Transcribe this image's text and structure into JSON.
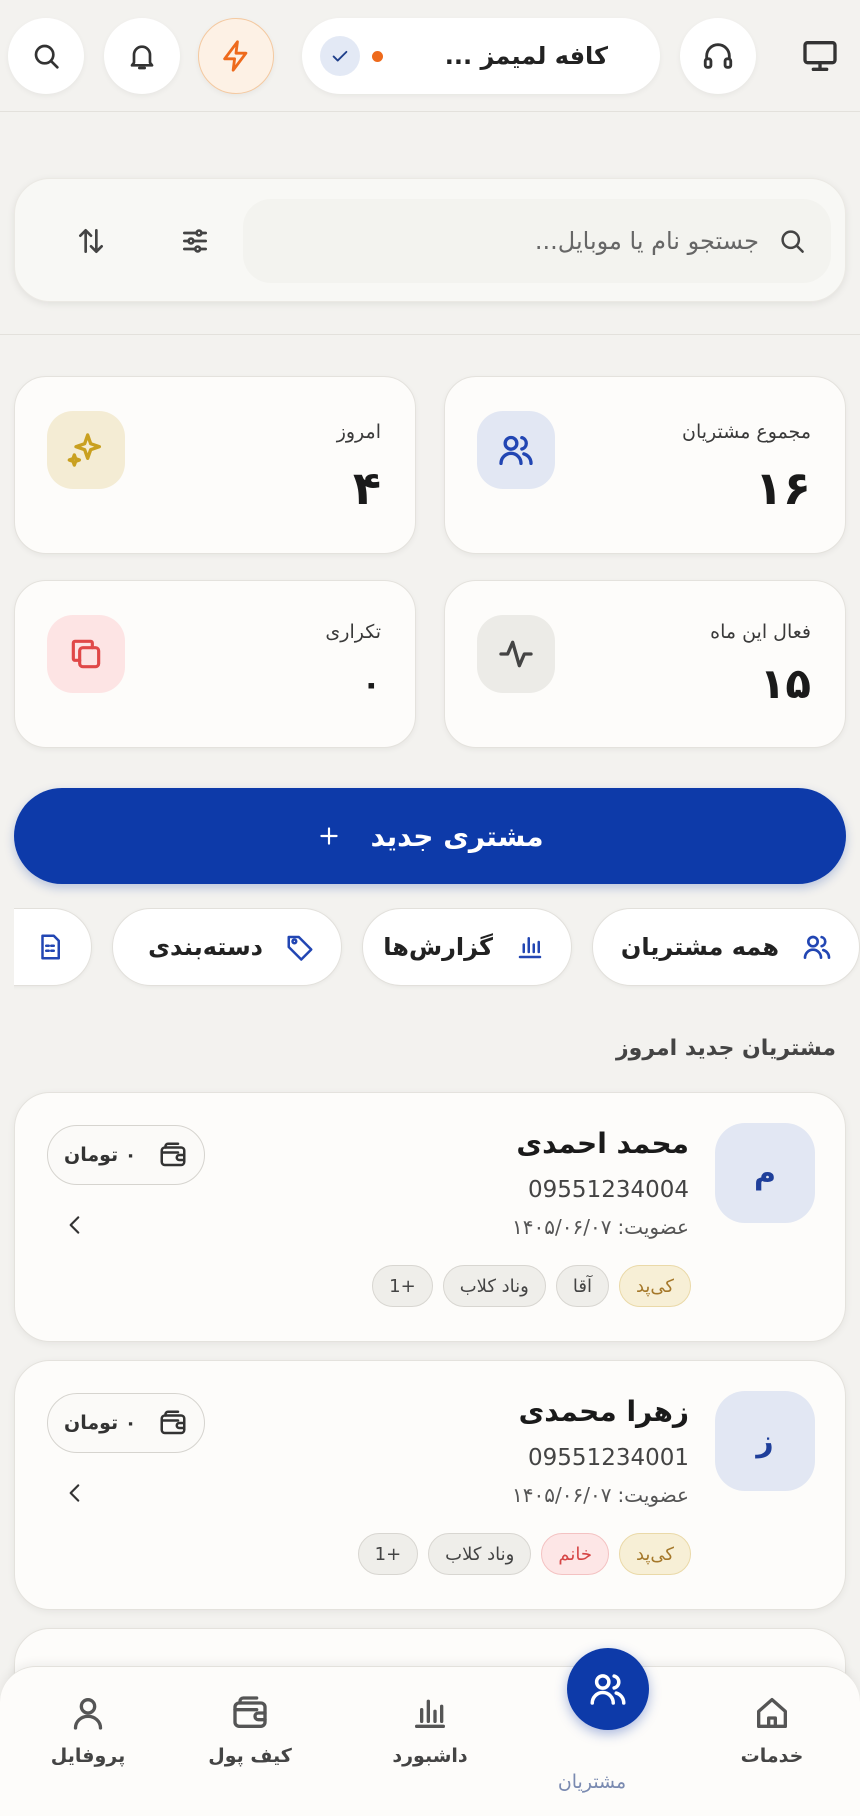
{
  "header": {
    "cafe_name": "کافه لمیمز ...",
    "status_dot_color": "#ee6a1c",
    "icons": [
      "desktop-icon",
      "headset-icon",
      "check-icon",
      "flash-icon",
      "bell-icon",
      "search-icon"
    ]
  },
  "search": {
    "placeholder": "جستجو نام یا موبایل..."
  },
  "stats": {
    "total": {
      "label": "مجموع مشتریان",
      "value": "۱۶"
    },
    "today": {
      "label": "امروز",
      "value": "۴"
    },
    "active_month": {
      "label": "فعال این ماه",
      "value": "۱۵"
    },
    "repeat": {
      "label": "تکراری",
      "value": "۰"
    }
  },
  "new_customer_label": "مشتری جدید",
  "chips": {
    "all": "همه مشتریان",
    "reports": "گزارش‌ها",
    "categories": "دسته‌بندی"
  },
  "section_title": "مشتریان جدید امروز",
  "customers": [
    {
      "initial": "م",
      "name": "محمد احمدی",
      "phone": "09551234004",
      "join_label": "عضویت:",
      "join_date": "۱۴۰۵/۰۶/۰۷",
      "wallet": "۰ تومان",
      "tags": [
        "کی‌پد",
        "آقا",
        "وناد کلاب",
        "+1"
      ]
    },
    {
      "initial": "ز",
      "name": "زهرا محمدی",
      "phone": "09551234001",
      "join_label": "عضویت:",
      "join_date": "۱۴۰۵/۰۶/۰۷",
      "wallet": "۰ تومان",
      "tags": [
        "کی‌پد",
        "خانم",
        "وناد کلاب",
        "+1"
      ]
    }
  ],
  "bottom_nav": {
    "services": "خدمات",
    "customers": "مشتریان",
    "dashboard": "داشبورد",
    "wallet": "کیف پول",
    "profile": "پروفایل"
  },
  "colors": {
    "primary": "#0d3aa9",
    "accent_orange": "#ee6a1c",
    "background": "#f3f2ef"
  }
}
